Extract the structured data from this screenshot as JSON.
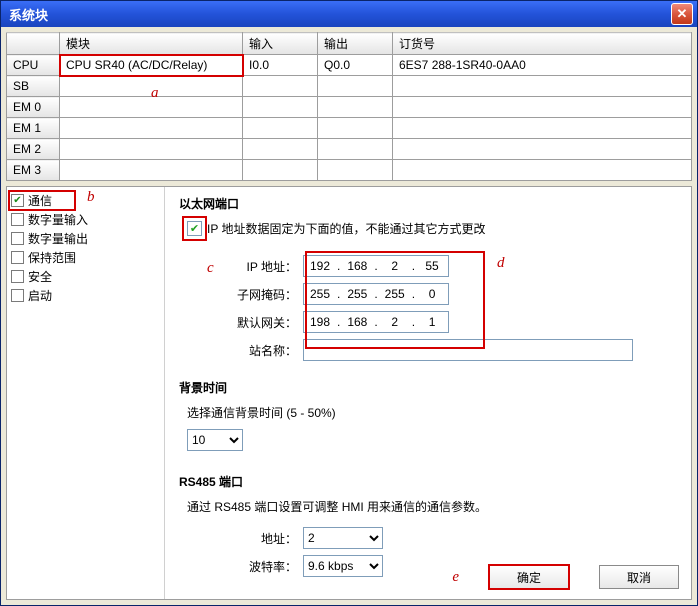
{
  "window": {
    "title": "系统块",
    "close_icon": "✕"
  },
  "table": {
    "headers": {
      "blank": "",
      "module": "模块",
      "input": "输入",
      "output": "输出",
      "order": "订货号"
    },
    "rows": [
      {
        "hd": "CPU",
        "module": "CPU SR40 (AC/DC/Relay)",
        "input": "I0.0",
        "output": "Q0.0",
        "order": "6ES7 288-1SR40-0AA0"
      },
      {
        "hd": "SB",
        "module": "",
        "input": "",
        "output": "",
        "order": ""
      },
      {
        "hd": "EM 0",
        "module": "",
        "input": "",
        "output": "",
        "order": ""
      },
      {
        "hd": "EM 1",
        "module": "",
        "input": "",
        "output": "",
        "order": ""
      },
      {
        "hd": "EM 2",
        "module": "",
        "input": "",
        "output": "",
        "order": ""
      },
      {
        "hd": "EM 3",
        "module": "",
        "input": "",
        "output": "",
        "order": ""
      }
    ]
  },
  "annotations": {
    "a": "a",
    "b": "b",
    "c": "c",
    "d": "d",
    "e": "e"
  },
  "sidebar": {
    "items": [
      {
        "label": "通信",
        "check": "✔"
      },
      {
        "label": "数字量输入",
        "check": ""
      },
      {
        "label": "数字量输出",
        "check": ""
      },
      {
        "label": "保持范围",
        "check": ""
      },
      {
        "label": "安全",
        "check": ""
      },
      {
        "label": "启动",
        "check": ""
      }
    ]
  },
  "eth": {
    "group_title": "以太网端口",
    "fixip_checked": "✔",
    "fixip_label": "IP 地址数据固定为下面的值，不能通过其它方式更改",
    "ip_label": "IP 地址：",
    "mask_label": "子网掩码：",
    "gw_label": "默认网关：",
    "station_label": "站名称：",
    "ip": {
      "a": "192",
      "b": "168",
      "c": "2",
      "d": "55"
    },
    "mask": {
      "a": "255",
      "b": "255",
      "c": "255",
      "d": "0"
    },
    "gw": {
      "a": "198",
      "b": "168",
      "c": "2",
      "d": "1"
    },
    "station": ""
  },
  "bg": {
    "group_title": "背景时间",
    "desc": "选择通信背景时间 (5 - 50%)",
    "value": "10"
  },
  "rs485": {
    "group_title": "RS485 端口",
    "desc": "通过 RS485 端口设置可调整 HMI 用来通信的通信参数。",
    "addr_label": "地址：",
    "baud_label": "波特率：",
    "addr": "2",
    "baud": "9.6 kbps"
  },
  "buttons": {
    "ok": "确定",
    "cancel": "取消"
  }
}
